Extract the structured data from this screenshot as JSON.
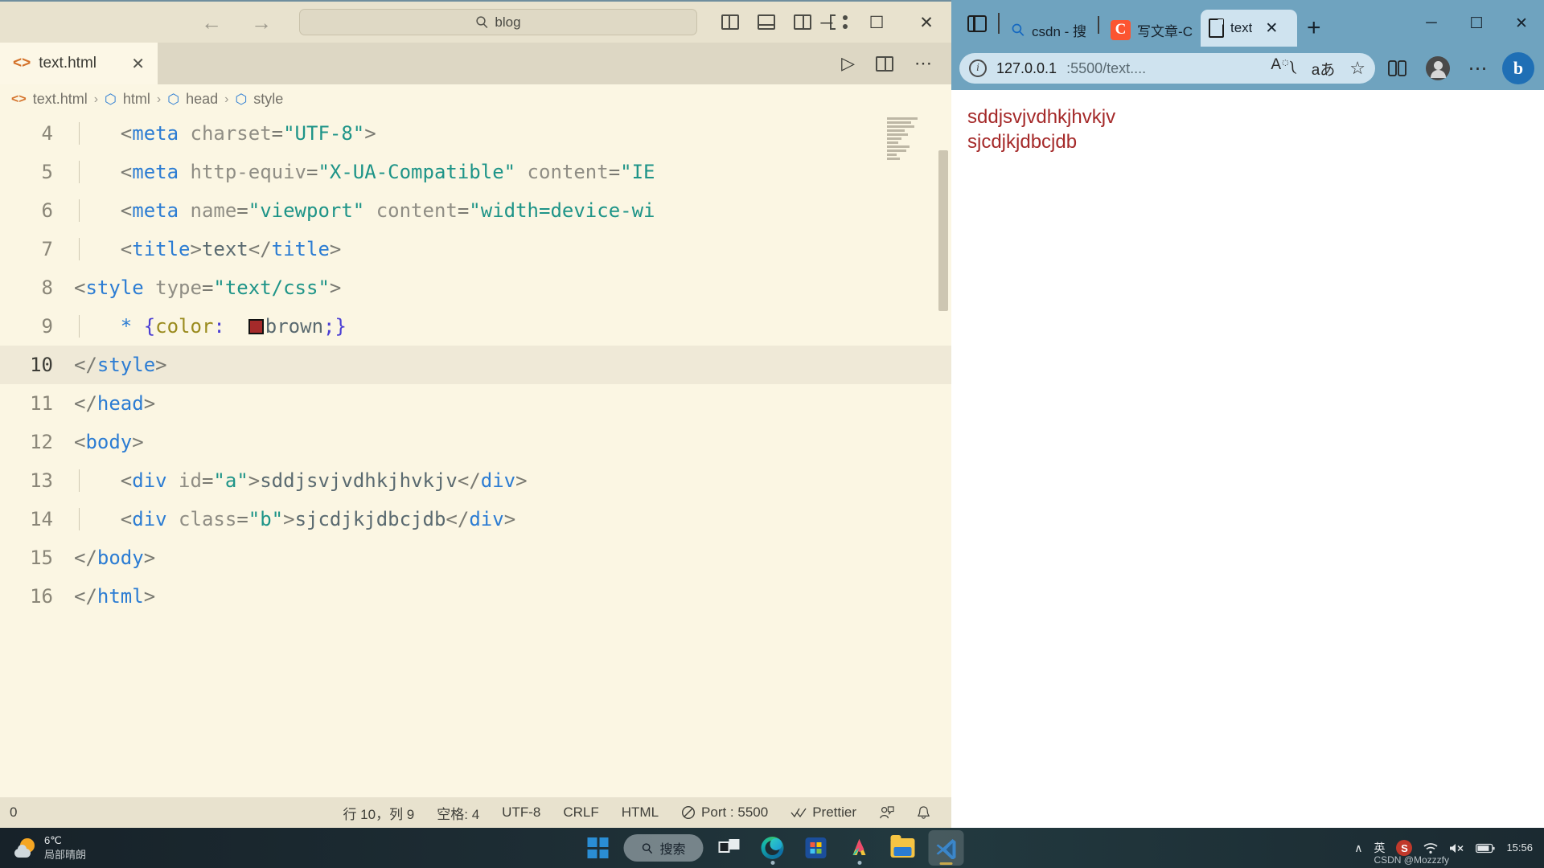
{
  "vscode": {
    "search_value": "blog",
    "search_icon": "search-icon",
    "nav": {
      "back": "←",
      "forward": "→"
    },
    "window_controls": {
      "minimize": "─",
      "maximize": "☐",
      "close": "✕"
    },
    "tab": {
      "label": "text.html",
      "icon": "html-file-icon",
      "close": "✕"
    },
    "tab_actions": {
      "run": "▷",
      "split": "split-editor-icon",
      "more": "⋯"
    },
    "breadcrumb": [
      {
        "label": "text.html",
        "icon": "html-file-icon"
      },
      {
        "label": "html",
        "icon": "cube-icon"
      },
      {
        "label": "head",
        "icon": "cube-icon"
      },
      {
        "label": "style",
        "icon": "cube-icon"
      }
    ],
    "breadcrumb_separator": "›",
    "code_lines": [
      {
        "num": "4",
        "indent": 1,
        "tokens": [
          {
            "t": "punc",
            "v": "<"
          },
          {
            "t": "tag",
            "v": "meta"
          },
          {
            "t": "attr",
            "v": " charset"
          },
          {
            "t": "punc",
            "v": "="
          },
          {
            "t": "str",
            "v": "\"UTF-8\""
          },
          {
            "t": "punc",
            "v": ">"
          }
        ]
      },
      {
        "num": "5",
        "indent": 1,
        "tokens": [
          {
            "t": "punc",
            "v": "<"
          },
          {
            "t": "tag",
            "v": "meta"
          },
          {
            "t": "attr",
            "v": " http-equiv"
          },
          {
            "t": "punc",
            "v": "="
          },
          {
            "t": "str",
            "v": "\"X-UA-Compatible\""
          },
          {
            "t": "attr",
            "v": " content"
          },
          {
            "t": "punc",
            "v": "="
          },
          {
            "t": "str",
            "v": "\"IE"
          }
        ]
      },
      {
        "num": "6",
        "indent": 1,
        "tokens": [
          {
            "t": "punc",
            "v": "<"
          },
          {
            "t": "tag",
            "v": "meta"
          },
          {
            "t": "attr",
            "v": " name"
          },
          {
            "t": "punc",
            "v": "="
          },
          {
            "t": "str",
            "v": "\"viewport\""
          },
          {
            "t": "attr",
            "v": " content"
          },
          {
            "t": "punc",
            "v": "="
          },
          {
            "t": "str",
            "v": "\"width=device-wi"
          }
        ]
      },
      {
        "num": "7",
        "indent": 1,
        "tokens": [
          {
            "t": "punc",
            "v": "<"
          },
          {
            "t": "tag",
            "v": "title"
          },
          {
            "t": "punc",
            "v": ">"
          },
          {
            "t": "txt",
            "v": "text"
          },
          {
            "t": "punc",
            "v": "</"
          },
          {
            "t": "tag",
            "v": "title"
          },
          {
            "t": "punc",
            "v": ">"
          }
        ]
      },
      {
        "num": "8",
        "indent": 0,
        "tokens": [
          {
            "t": "punc",
            "v": "<"
          },
          {
            "t": "tag",
            "v": "style"
          },
          {
            "t": "attr",
            "v": " type"
          },
          {
            "t": "punc",
            "v": "="
          },
          {
            "t": "str",
            "v": "\"text/css\""
          },
          {
            "t": "punc",
            "v": ">"
          }
        ]
      },
      {
        "num": "9",
        "indent": 1,
        "swatch": "#A52A2A",
        "tokens": [
          {
            "t": "sel",
            "v": "*"
          },
          {
            "t": "txt",
            "v": " "
          },
          {
            "t": "brace",
            "v": "{"
          },
          {
            "t": "prop",
            "v": "color"
          },
          {
            "t": "brace",
            "v": ":"
          },
          {
            "t": "txt",
            "v": "  "
          },
          {
            "t": "swatch",
            "v": ""
          },
          {
            "t": "txt",
            "v": "brown"
          },
          {
            "t": "brace",
            "v": ";}"
          }
        ]
      },
      {
        "num": "10",
        "indent": 0,
        "highlight": true,
        "tokens": [
          {
            "t": "punc",
            "v": "</"
          },
          {
            "t": "tag",
            "v": "style"
          },
          {
            "t": "punc",
            "v": ">"
          }
        ]
      },
      {
        "num": "11",
        "indent": 0,
        "tokens": [
          {
            "t": "punc",
            "v": "</"
          },
          {
            "t": "tag",
            "v": "head"
          },
          {
            "t": "punc",
            "v": ">"
          }
        ]
      },
      {
        "num": "12",
        "indent": 0,
        "tokens": [
          {
            "t": "punc",
            "v": "<"
          },
          {
            "t": "tag",
            "v": "body"
          },
          {
            "t": "punc",
            "v": ">"
          }
        ]
      },
      {
        "num": "13",
        "indent": 1,
        "tokens": [
          {
            "t": "punc",
            "v": "<"
          },
          {
            "t": "tag",
            "v": "div"
          },
          {
            "t": "attr",
            "v": " id"
          },
          {
            "t": "punc",
            "v": "="
          },
          {
            "t": "str",
            "v": "\"a\""
          },
          {
            "t": "punc",
            "v": ">"
          },
          {
            "t": "txt",
            "v": "sddjsvjvdhkjhvkjv"
          },
          {
            "t": "punc",
            "v": "</"
          },
          {
            "t": "tag",
            "v": "div"
          },
          {
            "t": "punc",
            "v": ">"
          }
        ]
      },
      {
        "num": "14",
        "indent": 1,
        "tokens": [
          {
            "t": "punc",
            "v": "<"
          },
          {
            "t": "tag",
            "v": "div"
          },
          {
            "t": "attr",
            "v": " class"
          },
          {
            "t": "punc",
            "v": "="
          },
          {
            "t": "str",
            "v": "\"b\""
          },
          {
            "t": "punc",
            "v": ">"
          },
          {
            "t": "txt",
            "v": "sjcdjkjdbcjdb"
          },
          {
            "t": "punc",
            "v": "</"
          },
          {
            "t": "tag",
            "v": "div"
          },
          {
            "t": "punc",
            "v": ">"
          }
        ]
      },
      {
        "num": "15",
        "indent": 0,
        "tokens": [
          {
            "t": "punc",
            "v": "</"
          },
          {
            "t": "tag",
            "v": "body"
          },
          {
            "t": "punc",
            "v": ">"
          }
        ]
      },
      {
        "num": "16",
        "indent": 0,
        "tokens": [
          {
            "t": "punc",
            "v": "</"
          },
          {
            "t": "tag",
            "v": "html"
          },
          {
            "t": "punc",
            "v": ">"
          }
        ]
      }
    ],
    "statusbar": {
      "left_remote": "0",
      "cursor": "行 10，列 9",
      "spaces": "空格: 4",
      "encoding": "UTF-8",
      "eol": "CRLF",
      "language": "HTML",
      "port": "Port : 5500",
      "port_icon": "no-entry-icon",
      "prettier": "Prettier",
      "prettier_icon": "double-check-icon",
      "account_icon": "account-icon",
      "bell_icon": "bell-icon"
    }
  },
  "edge": {
    "tabs": [
      {
        "label": "csdn - 搜",
        "icon": "search-icon",
        "active": false
      },
      {
        "label": "写文章-C",
        "icon": "csdn-icon",
        "active": false
      },
      {
        "label": "text",
        "icon": "document-icon",
        "active": true,
        "close": "✕"
      }
    ],
    "new_tab": "+",
    "tab_tools_icon": "tab-actions-icon",
    "window_controls": {
      "minimize": "─",
      "maximize": "☐",
      "close": "✕"
    },
    "address": {
      "url_host": "127.0.0.1",
      "url_path": ":5500/text....",
      "info_icon": "info-icon"
    },
    "toolbar_icons": {
      "read_aloud": "A༾",
      "translate": "aあ",
      "favorites": "☆",
      "collections": "collections-icon",
      "profile": "profile-avatar-icon",
      "copilot": "b"
    },
    "page": {
      "line1": "sddjsvjvdhkjhvkjv",
      "line2": "sjcdjkjdbcjdb",
      "text_color": "#A52A2A"
    }
  },
  "taskbar": {
    "weather": {
      "temp": "6℃",
      "desc": "局部晴朗",
      "icon": "sun-cloud-icon"
    },
    "start_icon": "windows-logo-icon",
    "search": {
      "label": "搜索",
      "icon": "search-icon"
    },
    "apps": [
      {
        "name": "task-view",
        "icon": "task-view-icon"
      },
      {
        "name": "edge",
        "icon": "edge-icon"
      },
      {
        "name": "microsoft-store",
        "icon": "store-icon"
      },
      {
        "name": "app-a",
        "icon": "a-app-icon"
      },
      {
        "name": "file-explorer",
        "icon": "folder-icon"
      },
      {
        "name": "vscode",
        "icon": "vscode-icon"
      }
    ],
    "tray": {
      "chevron": "∧",
      "ime": "英",
      "s_badge": "S",
      "wifi_icon": "wifi-icon",
      "volume_icon": "volume-muted-icon",
      "battery_icon": "battery-icon",
      "time": "15:56",
      "date": ""
    },
    "watermark": "CSDN @Mozzzfy"
  }
}
